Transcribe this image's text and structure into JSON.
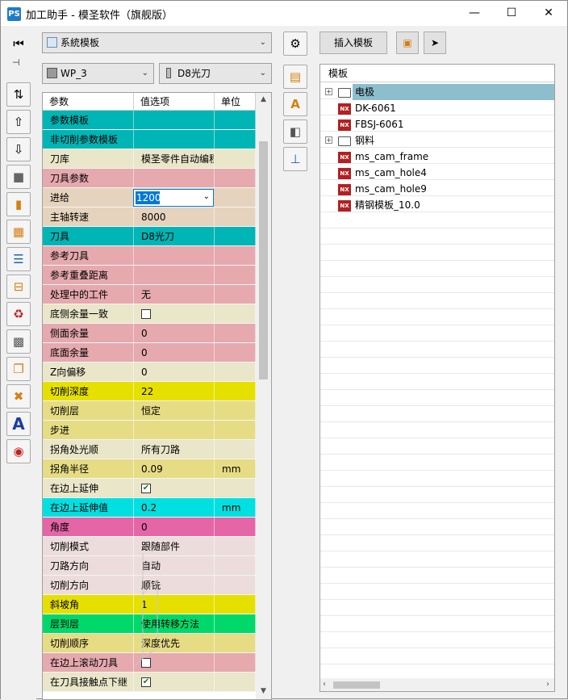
{
  "window": {
    "title": "加工助手 - 模圣软件（旗舰版）",
    "app_icon": "PS"
  },
  "template_select": {
    "value": "系統模板"
  },
  "wp_select": {
    "value": "WP_3"
  },
  "tool_select": {
    "value": "D8光刀"
  },
  "grid": {
    "headers": [
      "参数",
      "值选项",
      "单位"
    ],
    "rows": [
      {
        "label": "参数模板",
        "value": "",
        "unit": "",
        "color": "#00b5b5"
      },
      {
        "label": "非切削参数模板",
        "value": "",
        "unit": "",
        "color": "#00b5b5"
      },
      {
        "label": "刀库",
        "value": "模圣零件自动编程",
        "unit": "",
        "color": "#e9e6c9"
      },
      {
        "label": "刀具参数",
        "value": "",
        "unit": "",
        "color": "#e5a9ae"
      },
      {
        "label": "进给",
        "value": "1200",
        "unit": "",
        "color": "#e6d3bd"
      },
      {
        "label": "主轴转速",
        "value": "8000",
        "unit": "",
        "color": "#e6d3bd"
      },
      {
        "label": "刀具",
        "value": "D8光刀",
        "unit": "",
        "color": "#00b5b5"
      },
      {
        "label": "参考刀具",
        "value": "",
        "unit": "",
        "color": "#e5a9ae"
      },
      {
        "label": "参考重叠距离",
        "value": "",
        "unit": "",
        "color": "#e5a9ae"
      },
      {
        "label": "处理中的工件",
        "value": "无",
        "unit": "",
        "color": "#e5a9ae"
      },
      {
        "label": "底侧余量一致",
        "value": "",
        "unit": "",
        "color": "#e9e6c9",
        "checkbox": "unchecked"
      },
      {
        "label": "侧面余量",
        "value": "0",
        "unit": "",
        "color": "#e5a9ae"
      },
      {
        "label": "底面余量",
        "value": "0",
        "unit": "",
        "color": "#e5a9ae"
      },
      {
        "label": "Z向偏移",
        "value": "0",
        "unit": "",
        "color": "#e9e6c9"
      },
      {
        "label": "切削深度",
        "value": "22",
        "unit": "",
        "color": "#e6e000"
      },
      {
        "label": "切削层",
        "value": "恒定",
        "unit": "",
        "color": "#e6dc84"
      },
      {
        "label": "步进",
        "value": "",
        "unit": "",
        "color": "#e6dc84"
      },
      {
        "label": "拐角处光顺",
        "value": "所有刀路",
        "unit": "",
        "color": "#e9e6c9"
      },
      {
        "label": "拐角半径",
        "value": "0.09",
        "unit": "mm",
        "color": "#e6dc84"
      },
      {
        "label": "在边上延伸",
        "value": "",
        "unit": "",
        "color": "#e9e6c9",
        "checkbox": "checked"
      },
      {
        "label": "在边上延伸值",
        "value": "0.2",
        "unit": "mm",
        "color": "#00e0e0"
      },
      {
        "label": "角度",
        "value": "0",
        "unit": "",
        "color": "#e466a6"
      },
      {
        "label": "切削模式",
        "value": "跟随部件",
        "unit": "",
        "color": "#ecdcdc"
      },
      {
        "label": "刀路方向",
        "value": "自动",
        "unit": "",
        "color": "#ecdcdc"
      },
      {
        "label": "切削方向",
        "value": "顺铣",
        "unit": "",
        "color": "#ecdcdc"
      },
      {
        "label": "斜坡角",
        "value": "1",
        "unit": "",
        "color": "#e6e000"
      },
      {
        "label": "层到层",
        "value": "使用转移方法",
        "unit": "",
        "color": "#00d96a"
      },
      {
        "label": "切削顺序",
        "value": "深度优先",
        "unit": "",
        "color": "#e6dc84"
      },
      {
        "label": "在边上滚动刀具",
        "value": "",
        "unit": "",
        "color": "#e5a9ae",
        "checkbox": "unchecked"
      },
      {
        "label": "在刀具接触点下继",
        "value": "",
        "unit": "",
        "color": "#e9e6c9",
        "checkbox": "checked"
      }
    ]
  },
  "right": {
    "insert_btn": "插入模板",
    "tree_header": "模板",
    "items": [
      {
        "label": "电极",
        "type": "folder",
        "level": 0,
        "selected": true
      },
      {
        "label": "DK-6061",
        "type": "nx",
        "level": 1
      },
      {
        "label": "FBSJ-6061",
        "type": "nx",
        "level": 1
      },
      {
        "label": "钢料",
        "type": "folder",
        "level": 0
      },
      {
        "label": "ms_cam_frame",
        "type": "nx",
        "level": 1
      },
      {
        "label": "ms_cam_hole4",
        "type": "nx",
        "level": 1
      },
      {
        "label": "ms_cam_hole9",
        "type": "nx",
        "level": 1
      },
      {
        "label": "精钢模板_10.0",
        "type": "nx",
        "level": 1
      }
    ]
  },
  "colors": {
    "selected_row": "#8dbecd",
    "accent": "#0078d7"
  },
  "icons": {
    "nx": "NX"
  }
}
